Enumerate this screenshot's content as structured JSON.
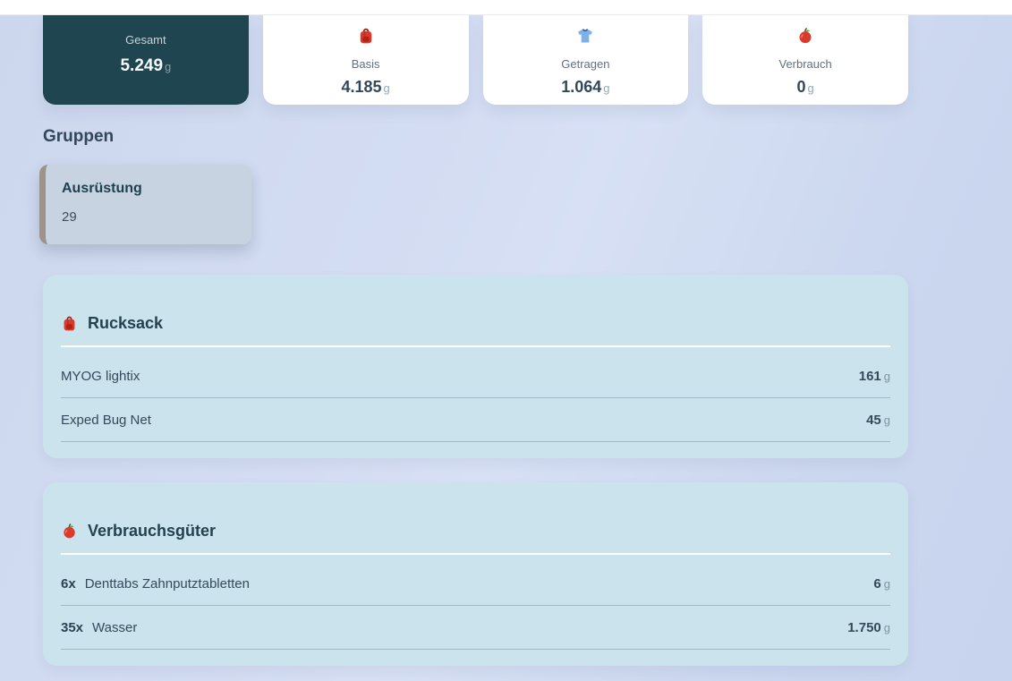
{
  "stats": {
    "cards": [
      {
        "label": "Gesamt",
        "value": "5.249",
        "unit": "g",
        "variant": "dark"
      },
      {
        "icon": "backpack-icon",
        "label": "Basis",
        "value": "4.185",
        "unit": "g"
      },
      {
        "icon": "tshirt-icon",
        "label": "Getragen",
        "value": "1.064",
        "unit": "g"
      },
      {
        "icon": "apple-icon",
        "label": "Verbrauch",
        "value": "0",
        "unit": "g"
      }
    ]
  },
  "groups": {
    "title": "Gruppen",
    "items": [
      {
        "name": "Ausrüstung",
        "count": "29"
      }
    ]
  },
  "categories": [
    {
      "icon": "backpack-icon",
      "title": "Rucksack",
      "items": [
        {
          "name": "MYOG lightix",
          "weight": "161",
          "unit": "g"
        },
        {
          "name": "Exped Bug Net",
          "weight": "45",
          "unit": "g"
        }
      ]
    },
    {
      "icon": "apple-icon",
      "title": "Verbrauchsgüter",
      "items": [
        {
          "qty": "6x",
          "name": "Denttabs Zahnputztabletten",
          "weight": "6",
          "unit": "g"
        },
        {
          "qty": "35x",
          "name": "Wasser",
          "weight": "1.750",
          "unit": "g"
        }
      ]
    }
  ],
  "colors": {
    "dark_card": "#1f4550",
    "category_card": "#cbe3ed",
    "group_card": "#c8d3e1",
    "group_stripe": "#9a948c",
    "background": "#ccd7ee"
  }
}
